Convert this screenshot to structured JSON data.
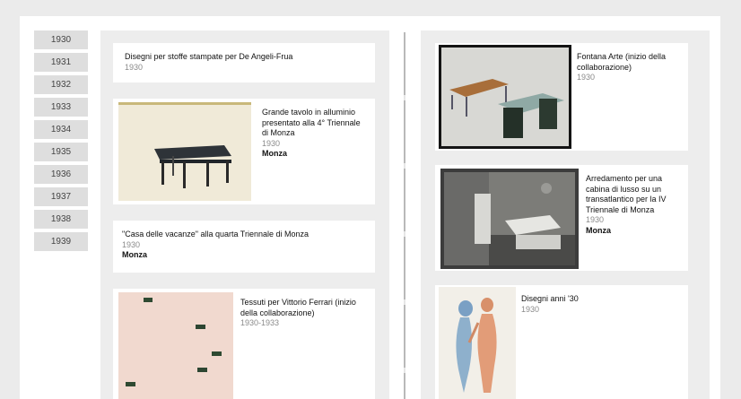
{
  "years": [
    "1930",
    "1931",
    "1932",
    "1933",
    "1934",
    "1935",
    "1936",
    "1937",
    "1938",
    "1939"
  ],
  "left_column": [
    {
      "title": "Disegni per stoffe stampate per De Angeli-Frua",
      "date": "1930",
      "place": ""
    },
    {
      "title": "Grande tavolo in alluminio presentato alla 4° Triennale di Monza",
      "date": "1930",
      "place": "Monza"
    },
    {
      "title": "\"Casa delle vacanze\" alla quarta Triennale di Monza",
      "date": "1930",
      "place": "Monza"
    },
    {
      "title": "Tessuti per Vittorio Ferrari (inizio della collaborazione)",
      "date": "1930-1933",
      "place": ""
    }
  ],
  "right_column": [
    {
      "title": "Fontana Arte (inizio della collaborazione)",
      "date": "1930",
      "place": ""
    },
    {
      "title": "Arredamento per una cabina di lusso su un transatlantico per la IV Triennale di Monza",
      "date": "1930",
      "place": "Monza"
    },
    {
      "title": "Disegni anni '30",
      "date": "1930",
      "place": ""
    }
  ]
}
